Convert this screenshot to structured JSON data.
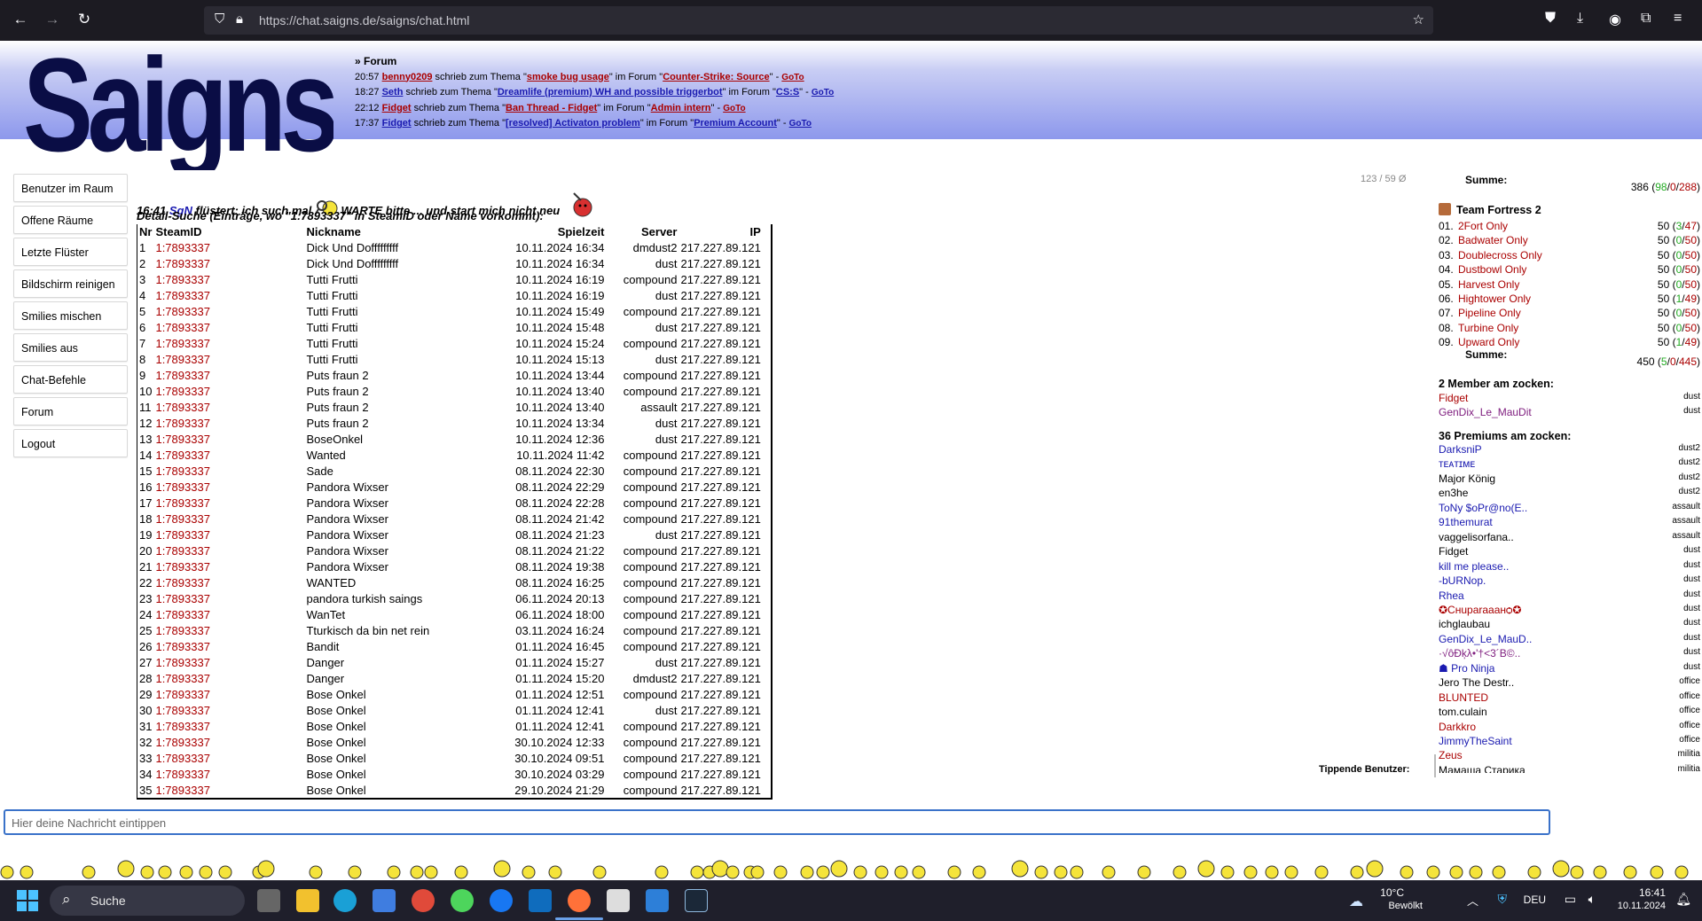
{
  "browser": {
    "url": "https://chat.saigns.de/saigns/chat.html"
  },
  "logo": {
    "text": "Saigns"
  },
  "forum": {
    "heading": "» Forum",
    "entries": [
      {
        "time": "20:57",
        "user": "benny0209",
        "action": " schrieb zum Thema \"",
        "topic": "smoke bug usage",
        "mid": "\" im Forum \"",
        "forum": "Counter-Strike: Source",
        "end": "\" -",
        "goto": "GoTo",
        "color": "red"
      },
      {
        "time": "18:27",
        "user": "Seth",
        "action": " schrieb zum Thema \"",
        "topic": "Dreamlife (premium) WH and possible triggerbot",
        "mid": "\" im Forum \"",
        "forum": "CS:S",
        "end": "\" -",
        "goto": "GoTo",
        "color": "blue"
      },
      {
        "time": "22:12",
        "user": "Fidget",
        "action": " schrieb zum Thema \"",
        "topic": "Ban Thread - Fidget",
        "mid": "\" im Forum \"",
        "forum": "Admin intern",
        "end": "\" -",
        "goto": "GoTo",
        "color": "red"
      },
      {
        "time": "17:37",
        "user": "Fidget",
        "action": " schrieb zum Thema \"",
        "topic": "[resolved] Activaton problem",
        "mid": "\" im Forum \"",
        "forum": "Premium Account",
        "end": "\" -",
        "goto": "GoTo",
        "color": "blue"
      }
    ]
  },
  "menu": [
    "Benutzer im Raum",
    "Offene Räume",
    "Letzte Flüster",
    "Bildschirm reinigen",
    "Smilies mischen",
    "Smilies aus",
    "Chat-Befehle",
    "Forum",
    "Logout"
  ],
  "chat": {
    "counter": "123 / 59 Ø",
    "message": {
      "time": "16:41",
      "nick": "SgN",
      "text1": " flüstert: ich such mal ",
      "text2": " WARTE bitte ... und start mich nicht neu"
    },
    "detail": "Detail-Suche (Einträge, wo \"1:7893337\" in SteamID oder Name vorkommt):"
  },
  "table": {
    "headers": [
      "Nr",
      "SteamID",
      "Nickname",
      "Spielzeit",
      "Server",
      "IP"
    ],
    "rows": [
      [
        "1",
        "1:7893337",
        "Dick Und Dofffffffff",
        "10.11.2024 16:34",
        "dmdust2",
        "217.227.89.121"
      ],
      [
        "2",
        "1:7893337",
        "Dick Und Dofffffffff",
        "10.11.2024 16:34",
        "dust",
        "217.227.89.121"
      ],
      [
        "3",
        "1:7893337",
        "Tutti Frutti",
        "10.11.2024 16:19",
        "compound",
        "217.227.89.121"
      ],
      [
        "4",
        "1:7893337",
        "Tutti Frutti",
        "10.11.2024 16:19",
        "dust",
        "217.227.89.121"
      ],
      [
        "5",
        "1:7893337",
        "Tutti Frutti",
        "10.11.2024 15:49",
        "compound",
        "217.227.89.121"
      ],
      [
        "6",
        "1:7893337",
        "Tutti Frutti",
        "10.11.2024 15:48",
        "dust",
        "217.227.89.121"
      ],
      [
        "7",
        "1:7893337",
        "Tutti Frutti",
        "10.11.2024 15:24",
        "compound",
        "217.227.89.121"
      ],
      [
        "8",
        "1:7893337",
        "Tutti Frutti",
        "10.11.2024 15:13",
        "dust",
        "217.227.89.121"
      ],
      [
        "9",
        "1:7893337",
        "Puts fraun 2",
        "10.11.2024 13:44",
        "compound",
        "217.227.89.121"
      ],
      [
        "10",
        "1:7893337",
        "Puts fraun 2",
        "10.11.2024 13:40",
        "compound",
        "217.227.89.121"
      ],
      [
        "11",
        "1:7893337",
        "Puts fraun 2",
        "10.11.2024 13:40",
        "assault",
        "217.227.89.121"
      ],
      [
        "12",
        "1:7893337",
        "Puts fraun 2",
        "10.11.2024 13:34",
        "dust",
        "217.227.89.121"
      ],
      [
        "13",
        "1:7893337",
        "BoseOnkel",
        "10.11.2024 12:36",
        "dust",
        "217.227.89.121"
      ],
      [
        "14",
        "1:7893337",
        "Wanted",
        "10.11.2024 11:42",
        "compound",
        "217.227.89.121"
      ],
      [
        "15",
        "1:7893337",
        "Sade",
        "08.11.2024 22:30",
        "compound",
        "217.227.89.121"
      ],
      [
        "16",
        "1:7893337",
        "Pandora Wixser",
        "08.11.2024 22:29",
        "compound",
        "217.227.89.121"
      ],
      [
        "17",
        "1:7893337",
        "Pandora Wixser",
        "08.11.2024 22:28",
        "compound",
        "217.227.89.121"
      ],
      [
        "18",
        "1:7893337",
        "Pandora Wixser",
        "08.11.2024 21:42",
        "compound",
        "217.227.89.121"
      ],
      [
        "19",
        "1:7893337",
        "Pandora Wixser",
        "08.11.2024 21:23",
        "dust",
        "217.227.89.121"
      ],
      [
        "20",
        "1:7893337",
        "Pandora Wixser",
        "08.11.2024 21:22",
        "compound",
        "217.227.89.121"
      ],
      [
        "21",
        "1:7893337",
        "Pandora Wixser",
        "08.11.2024 19:38",
        "compound",
        "217.227.89.121"
      ],
      [
        "22",
        "1:7893337",
        "WANTED",
        "08.11.2024 16:25",
        "compound",
        "217.227.89.121"
      ],
      [
        "23",
        "1:7893337",
        "pandora turkish saings",
        "06.11.2024 20:13",
        "compound",
        "217.227.89.121"
      ],
      [
        "24",
        "1:7893337",
        "WanTet",
        "06.11.2024 18:00",
        "compound",
        "217.227.89.121"
      ],
      [
        "25",
        "1:7893337",
        "Tturkisch da bin net rein",
        "03.11.2024 16:24",
        "compound",
        "217.227.89.121"
      ],
      [
        "26",
        "1:7893337",
        "Bandit",
        "01.11.2024 16:45",
        "compound",
        "217.227.89.121"
      ],
      [
        "27",
        "1:7893337",
        "Danger",
        "01.11.2024 15:27",
        "dust",
        "217.227.89.121"
      ],
      [
        "28",
        "1:7893337",
        "Danger",
        "01.11.2024 15:20",
        "dmdust2",
        "217.227.89.121"
      ],
      [
        "29",
        "1:7893337",
        "Bose Onkel",
        "01.11.2024 12:51",
        "compound",
        "217.227.89.121"
      ],
      [
        "30",
        "1:7893337",
        "Bose Onkel",
        "01.11.2024 12:41",
        "dust",
        "217.227.89.121"
      ],
      [
        "31",
        "1:7893337",
        "Bose Onkel",
        "01.11.2024 12:41",
        "compound",
        "217.227.89.121"
      ],
      [
        "32",
        "1:7893337",
        "Bose Onkel",
        "30.10.2024 12:33",
        "compound",
        "217.227.89.121"
      ],
      [
        "33",
        "1:7893337",
        "Bose Onkel",
        "30.10.2024 09:51",
        "compound",
        "217.227.89.121"
      ],
      [
        "34",
        "1:7893337",
        "Bose Onkel",
        "30.10.2024 03:29",
        "compound",
        "217.227.89.121"
      ],
      [
        "35",
        "1:7893337",
        "Bose Onkel",
        "29.10.2024 21:29",
        "compound",
        "217.227.89.121"
      ]
    ]
  },
  "right": {
    "summe1": {
      "label": "Summe:",
      "total": "386",
      "a": "98",
      "b": "0",
      "c": "288"
    },
    "tf2": {
      "title": "Team Fortress 2",
      "servers": [
        {
          "n": "01.",
          "name": "2Fort Only",
          "v": "50",
          "a": "3",
          "c": "47"
        },
        {
          "n": "02.",
          "name": "Badwater Only",
          "v": "50",
          "a": "0",
          "c": "50"
        },
        {
          "n": "03.",
          "name": "Doublecross Only",
          "v": "50",
          "a": "0",
          "c": "50"
        },
        {
          "n": "04.",
          "name": "Dustbowl Only",
          "v": "50",
          "a": "0",
          "c": "50"
        },
        {
          "n": "05.",
          "name": "Harvest Only",
          "v": "50",
          "a": "0",
          "c": "50"
        },
        {
          "n": "06.",
          "name": "Hightower Only",
          "v": "50",
          "a": "1",
          "c": "49"
        },
        {
          "n": "07.",
          "name": "Pipeline Only",
          "v": "50",
          "a": "0",
          "c": "50"
        },
        {
          "n": "08.",
          "name": "Turbine Only",
          "v": "50",
          "a": "0",
          "c": "50"
        },
        {
          "n": "09.",
          "name": "Upward Only",
          "v": "50",
          "a": "1",
          "c": "49"
        }
      ],
      "summe": {
        "label": "Summe:",
        "total": "450",
        "a": "5",
        "b": "0",
        "c": "445"
      }
    },
    "members_heading": "2 Member am zocken:",
    "members": [
      {
        "name": "Fidget",
        "server": "dust",
        "color": "#a00"
      },
      {
        "name": "GenDix_Le_MauDit",
        "server": "dust",
        "color": "#802080"
      }
    ],
    "premiums_heading": "36 Premiums am zocken:",
    "premiums": [
      {
        "name": "DarksniP",
        "server": "dust2",
        "color": "#1a1ab0"
      },
      {
        "name": "ᴛᴇᴀᴛɪᴍᴇ",
        "server": "dust2",
        "color": "#1a1ab0"
      },
      {
        "name": "Major König",
        "server": "dust2",
        "color": "#000"
      },
      {
        "name": "en3he",
        "server": "dust2",
        "color": "#000"
      },
      {
        "name": "ToNy $oPr@no(E..",
        "server": "assault",
        "color": "#1a1ab0"
      },
      {
        "name": "91themurat",
        "server": "assault",
        "color": "#1a1ab0"
      },
      {
        "name": "vaggelisorfana..",
        "server": "assault",
        "color": "#000"
      },
      {
        "name": "Fidget",
        "server": "dust",
        "color": "#000"
      },
      {
        "name": "kill me please..",
        "server": "dust",
        "color": "#1a1ab0"
      },
      {
        "name": "-bURNop.",
        "server": "dust",
        "color": "#1a1ab0"
      },
      {
        "name": "Rhea",
        "server": "dust",
        "color": "#1a1ab0"
      },
      {
        "name": "✪Cʜuparaaaнѻ✪",
        "server": "dust",
        "color": "#a00"
      },
      {
        "name": "ichglaubau",
        "server": "dust",
        "color": "#000"
      },
      {
        "name": "GenDix_Le_MauD..",
        "server": "dust",
        "color": "#1a1ab0"
      },
      {
        "name": "·√ôÐķλ•'†<3´B©..",
        "server": "dust",
        "color": "#802080"
      },
      {
        "name": "☗ Pro Ninja",
        "server": "dust",
        "color": "#1a1ab0"
      },
      {
        "name": "Jero The Destr..",
        "server": "office",
        "color": "#000"
      },
      {
        "name": "BLUNTED",
        "server": "office",
        "color": "#a00"
      },
      {
        "name": "tom.culain",
        "server": "office",
        "color": "#000"
      },
      {
        "name": "Darkkro",
        "server": "office",
        "color": "#a00"
      },
      {
        "name": "JimmyTheSaint",
        "server": "office",
        "color": "#1a1ab0"
      },
      {
        "name": "Zeus",
        "server": "militia",
        "color": "#a00"
      },
      {
        "name": "Мамаша Старика",
        "server": "militia",
        "color": "#000"
      }
    ],
    "tippende": "Tippende Benutzer:"
  },
  "input": {
    "placeholder": "Hier deine Nachricht eintippen"
  },
  "taskbar": {
    "search": "Suche",
    "weather_temp": "10°C",
    "weather_desc": "Bewölkt",
    "lang": "DEU",
    "time": "16:41",
    "date": "10.11.2024"
  }
}
